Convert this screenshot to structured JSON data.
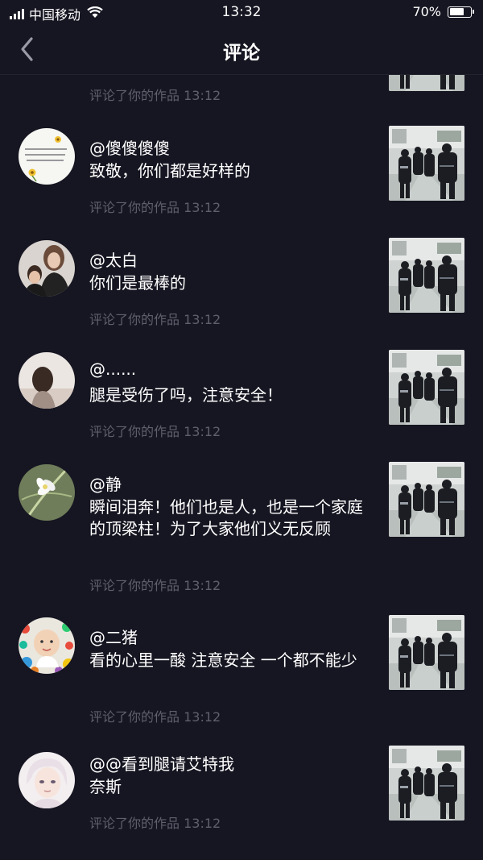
{
  "status_bar": {
    "carrier": "中国移动",
    "time": "13:32",
    "battery": "70%",
    "battery_level": 0.7
  },
  "nav": {
    "title": "评论"
  },
  "partial_meta": "评论了你的作品  13:12",
  "comments": [
    {
      "user": "@傻傻傻傻",
      "text": "致敬，你们都是好样的",
      "meta": "评论了你的作品  13:12"
    },
    {
      "user": "@太白",
      "text": "你们是最棒的",
      "meta": "评论了你的作品  13:12"
    },
    {
      "user": "@......",
      "text": "腿是受伤了吗，注意安全！",
      "meta": "评论了你的作品  13:12"
    },
    {
      "user": "@静",
      "text": "瞬间泪奔！他们也是人，也是一个家庭的顶梁柱！为了大家他们义无反顾",
      "meta": "评论了你的作品  13:12"
    },
    {
      "user": "@二猪",
      "text": "看的心里一酸 注意安全 一个都不能少",
      "meta": "评论了你的作品  13:12"
    },
    {
      "user": "@@看到腿请艾特我",
      "text": "奈斯",
      "meta": "评论了你的作品  13:12"
    }
  ]
}
